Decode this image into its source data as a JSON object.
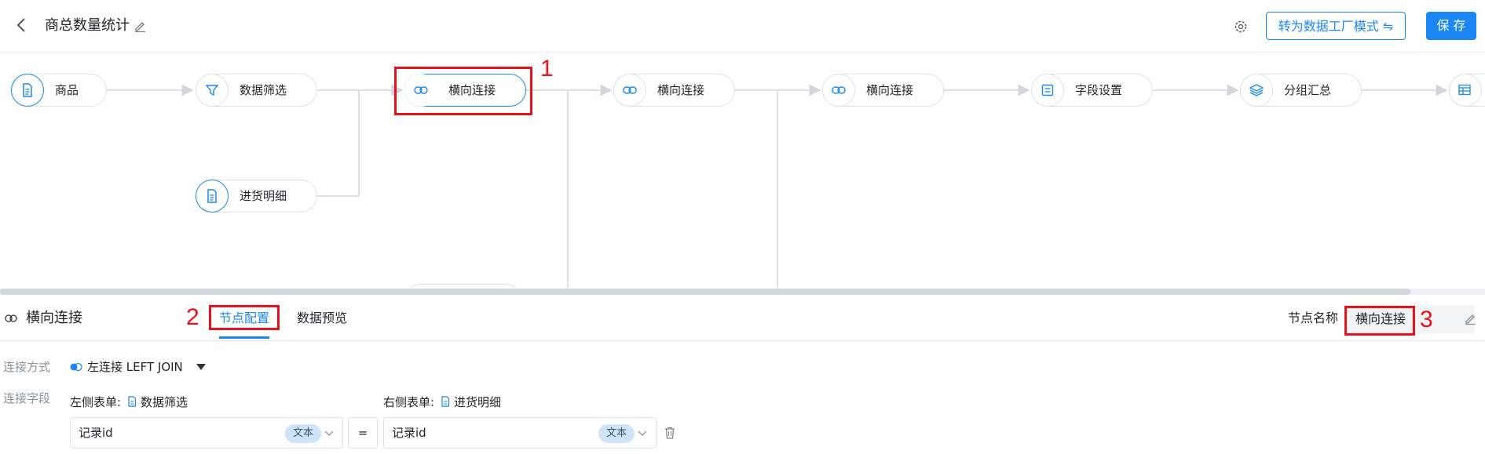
{
  "header": {
    "title": "商总数量统计",
    "mode_button": "转为数据工厂模式 ⇋",
    "save_button": "保 存"
  },
  "canvas": {
    "nodes": [
      {
        "label": "商品",
        "icon": "document-icon"
      },
      {
        "label": "数据筛选",
        "icon": "filter-icon"
      },
      {
        "label": "横向连接",
        "icon": "link-icon"
      },
      {
        "label": "横向连接",
        "icon": "link-icon"
      },
      {
        "label": "横向连接",
        "icon": "link-icon"
      },
      {
        "label": "字段设置",
        "icon": "form-icon"
      },
      {
        "label": "分组汇总",
        "icon": "layers-icon"
      },
      {
        "label": "进货明细",
        "icon": "document-icon"
      }
    ],
    "annotation_1": "1"
  },
  "panel": {
    "title": "横向连接",
    "tabs": [
      "节点配置",
      "数据预览"
    ],
    "annotation_2": "2",
    "node_name_label": "节点名称",
    "node_name_value": "横向连接",
    "annotation_3": "3",
    "join_label": "连接方式",
    "join_value": "左连接 LEFT JOIN",
    "field_label": "连接字段",
    "left_table_label": "左侧表单:",
    "left_table_name": "数据筛选",
    "right_table_label": "右侧表单:",
    "right_table_name": "进货明细",
    "left_field": "记录id",
    "left_type": "文本",
    "equals": "=",
    "right_field": "记录id",
    "right_type": "文本"
  },
  "colors": {
    "accent": "#1b87f5",
    "annotation": "#e8121b"
  }
}
